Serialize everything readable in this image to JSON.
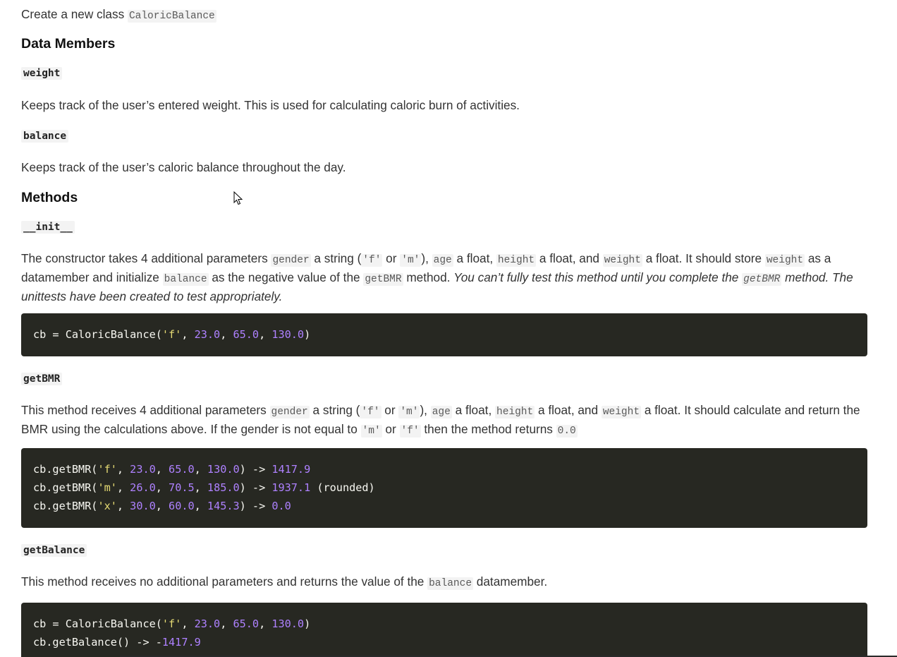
{
  "intro": {
    "text_before": "Create a new class ",
    "class_name": "CaloricBalance"
  },
  "data_members": {
    "heading": "Data Members",
    "weight": {
      "name": "weight",
      "desc": "Keeps track of the user’s entered weight. This is used for calculating caloric burn of activities."
    },
    "balance": {
      "name": "balance",
      "desc": "Keeps track of the user’s caloric balance throughout the day."
    }
  },
  "methods": {
    "heading": "Methods",
    "init": {
      "name": "__init__",
      "p1": "The constructor takes 4 additional parameters ",
      "gender": "gender",
      "p2": " a string (",
      "f": "'f'",
      "or": " or ",
      "m": "'m'",
      "p3": "), ",
      "age": "age",
      "p4": " a float, ",
      "height": "height",
      "p5": " a float, and ",
      "weight": "weight",
      "p6": " a float. It should store ",
      "weight2": "weight",
      "p7": " as a datamember and initialize ",
      "balance": "balance",
      "p8": " as the negative value of the ",
      "getBMR": "getBMR",
      "p9": " method. ",
      "em1": "You can’t fully test this method until you complete the ",
      "em_code": "getBMR",
      "em2": " method. The unittests have been created to test appropriately.",
      "code": {
        "l1_a": "cb = CaloricBalance(",
        "l1_s": "'f'",
        "l1_c1": ", ",
        "l1_n1": "23.0",
        "l1_c2": ", ",
        "l1_n2": "65.0",
        "l1_c3": ", ",
        "l1_n3": "130.0",
        "l1_end": ")"
      }
    },
    "getbmr": {
      "name": "getBMR",
      "p1": "This method receives 4 additional parameters ",
      "gender": "gender",
      "p2": " a string (",
      "f": "'f'",
      "or": " or ",
      "m": "'m'",
      "p3": "), ",
      "age": "age",
      "p4": " a float, ",
      "height": "height",
      "p5": " a float, and ",
      "weight": "weight",
      "p6": " a float. It should calculate and return the BMR using the calculations above. If the gender is not equal to ",
      "m2": "'m'",
      "or2": " or ",
      "f2": "'f'",
      "p7": " then the method returns ",
      "zero": "0.0",
      "code": {
        "l1_a": "cb.getBMR(",
        "l1_s": "'f'",
        "l1_n1": "23.0",
        "l1_n2": "65.0",
        "l1_n3": "130.0",
        "l1_arrow": ") -> ",
        "l1_res": "1417.9",
        "l1_tail": "",
        "l2_a": "cb.getBMR(",
        "l2_s": "'m'",
        "l2_n1": "26.0",
        "l2_n2": "70.5",
        "l2_n3": "185.0",
        "l2_arrow": ") -> ",
        "l2_res": "1937.1",
        "l2_tail": " (rounded)",
        "l3_a": "cb.getBMR(",
        "l3_s": "'x'",
        "l3_n1": "30.0",
        "l3_n2": "60.0",
        "l3_n3": "145.3",
        "l3_arrow": ") -> ",
        "l3_res": "0.0",
        "l3_tail": ""
      }
    },
    "getbalance": {
      "name": "getBalance",
      "p1": "This method receives no additional parameters and returns the value of the ",
      "balance": "balance",
      "p2": " datamember.",
      "code": {
        "l1_a": "cb = CaloricBalance(",
        "l1_s": "'f'",
        "l1_n1": "23.0",
        "l1_n2": "65.0",
        "l1_n3": "130.0",
        "l1_end": ")",
        "l2_a": "cb.getBalance() -> ",
        "l2_minus": "-",
        "l2_res": "1417.9"
      }
    }
  }
}
